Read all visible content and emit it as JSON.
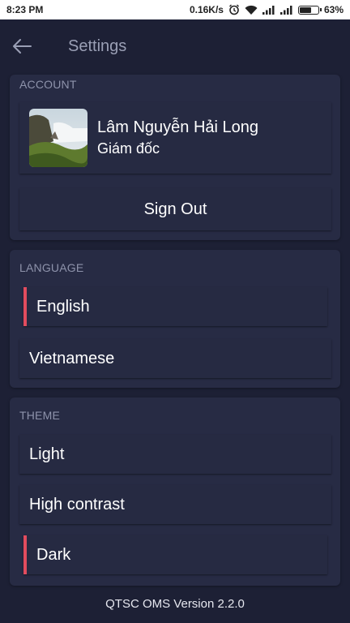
{
  "status_bar": {
    "time": "8:23 PM",
    "network_speed": "0.16K/s",
    "battery_percent": "63%",
    "battery_level": 0.63
  },
  "app_bar": {
    "title": "Settings",
    "back_icon": "arrow-left-icon"
  },
  "account": {
    "header": "ACCOUNT",
    "name": "Lâm Nguyễn Hải Long",
    "role": "Giám đốc",
    "sign_out_label": "Sign Out"
  },
  "language": {
    "header": "LANGUAGE",
    "options": [
      {
        "label": "English",
        "selected": true
      },
      {
        "label": "Vietnamese",
        "selected": false
      }
    ]
  },
  "theme": {
    "header": "THEME",
    "options": [
      {
        "label": "Light",
        "selected": false
      },
      {
        "label": "High contrast",
        "selected": false
      },
      {
        "label": "Dark",
        "selected": true
      }
    ]
  },
  "footer": {
    "version": "QTSC OMS Version 2.2.0"
  },
  "colors": {
    "background": "#1d2035",
    "card": "#272b44",
    "accent": "#e24c5e"
  }
}
